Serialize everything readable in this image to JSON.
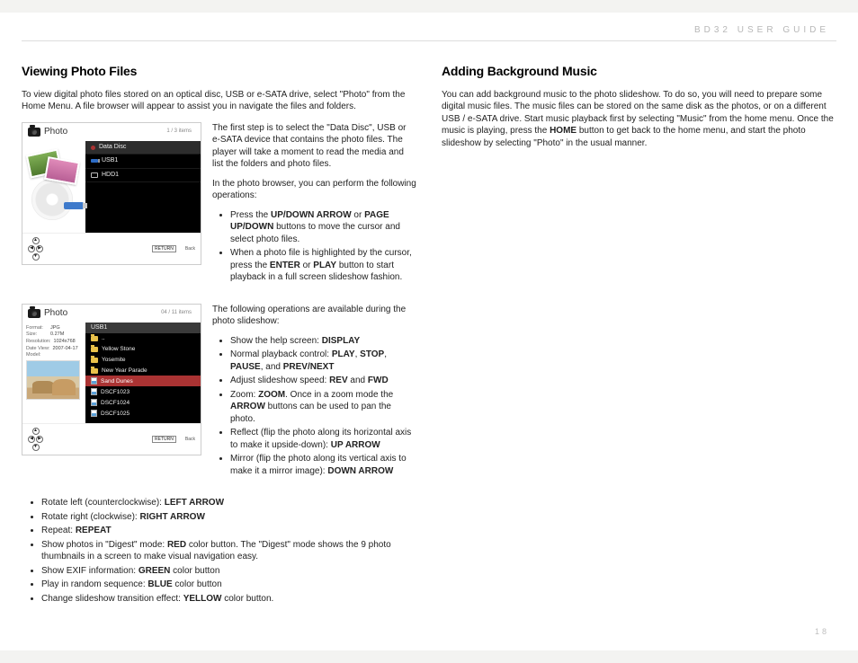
{
  "header": {
    "guide": "BD32 USER GUIDE"
  },
  "page_number": "18",
  "left": {
    "h1": "Viewing Photo Files",
    "intro": "To view digital photo files stored on an optical disc, USB or e-SATA drive, select \"Photo\" from the Home Menu. A file browser will appear to assist you in navigate the files and folders.",
    "fig1": {
      "title": "Photo",
      "count": "1 / 3 items",
      "rows": {
        "data": "Data Disc",
        "usb": "USB1",
        "hdd": "HDD1"
      },
      "return": "RETURN",
      "returnlbl": "Back",
      "text1": "The first step is to select the \"Data Disc\", USB or e-SATA device that contains the photo files.  The player will take a moment to read the media and list the folders and photo files.",
      "text2": "In the photo browser, you can perform the following operations:",
      "bullets": [
        {
          "pre": "Press the ",
          "b1": "UP/DOWN ARROW",
          "mid": " or ",
          "b2": "PAGE UP/DOWN",
          "post": " buttons to move the cursor and select photo files."
        },
        {
          "pre": "When a photo file is highlighted by the cursor, press the ",
          "b1": "ENTER",
          "mid": " or ",
          "b2": "PLAY",
          "post": " button to start playback in a full screen slideshow fashion."
        }
      ]
    },
    "fig2": {
      "title": "Photo",
      "count": "04 / 11 items",
      "meta": {
        "format_k": "Format:",
        "format_v": "JPG",
        "size_k": "Size:",
        "size_v": "0.27M",
        "res_k": "Resolution:",
        "res_v": "1024x768",
        "date_k": "Date View:",
        "date_v": "2007-04-17",
        "model_k": "Model:"
      },
      "usb1": "USB1",
      "items": {
        "up": "..",
        "a": "Yellow Stone",
        "b": "Yosemite",
        "c": "New Year Parade",
        "sel": "Sand Dunes",
        "d": "DSCF1023",
        "e": "DSCF1024",
        "f": "DSCF1025"
      },
      "intro": "The following operations are available during the photo slideshow:",
      "bullets_a": [
        {
          "pre": "Show the help screen: ",
          "b": "DISPLAY"
        },
        {
          "pre": "Normal playback control: ",
          "b": "PLAY",
          "m": ", ",
          "b2": "STOP",
          "m2": ", ",
          "b3": "PAUSE",
          "m3": ", and ",
          "b4": "PREV/NEXT"
        },
        {
          "pre": "Adjust slideshow speed: ",
          "b": "REV",
          "m": " and ",
          "b2": "FWD"
        },
        {
          "pre": "Zoom: ",
          "b": "ZOOM",
          "post": ".  Once in a zoom mode the ",
          "b2": "ARROW",
          "post2": " buttons can be used to pan the photo."
        },
        {
          "pre": "Reflect (flip the photo along its horizontal axis to make it upside-down): ",
          "b": "UP ARROW"
        },
        {
          "pre": "Mirror (flip the photo along its vertical axis to make it a mirror image): ",
          "b": "DOWN ARROW"
        }
      ]
    },
    "bullets_b": [
      {
        "pre": "Rotate left (counterclockwise): ",
        "b": "LEFT ARROW"
      },
      {
        "pre": "Rotate right (clockwise): ",
        "b": "RIGHT ARROW"
      },
      {
        "pre": "Repeat: ",
        "b": "REPEAT"
      },
      {
        "pre": "Show photos in \"Digest\" mode: ",
        "b": "RED",
        "post": " color button. The \"Digest\" mode shows the 9 photo thumbnails in a screen to make visual navigation easy."
      },
      {
        "pre": "Show EXIF information: ",
        "b": "GREEN",
        "post": " color button"
      },
      {
        "pre": "Play in random sequence: ",
        "b": "BLUE",
        "post": " color button"
      },
      {
        "pre": "Change slideshow transition effect: ",
        "b": "YELLOW",
        "post": " color button."
      }
    ]
  },
  "right": {
    "h1": "Adding Background Music",
    "p_pre": "You can add background music to the photo slideshow.  To do so, you will need to prepare some digital music files.  The music files can be stored on the same disk as the photos, or on a different USB / e-SATA drive.  Start music playback first by selecting \"Music\" from the home menu.  Once the music is playing, press the ",
    "p_b": "HOME",
    "p_post": " button to get back to the home menu, and start the photo slideshow by selecting \"Photo\" in the usual manner."
  }
}
